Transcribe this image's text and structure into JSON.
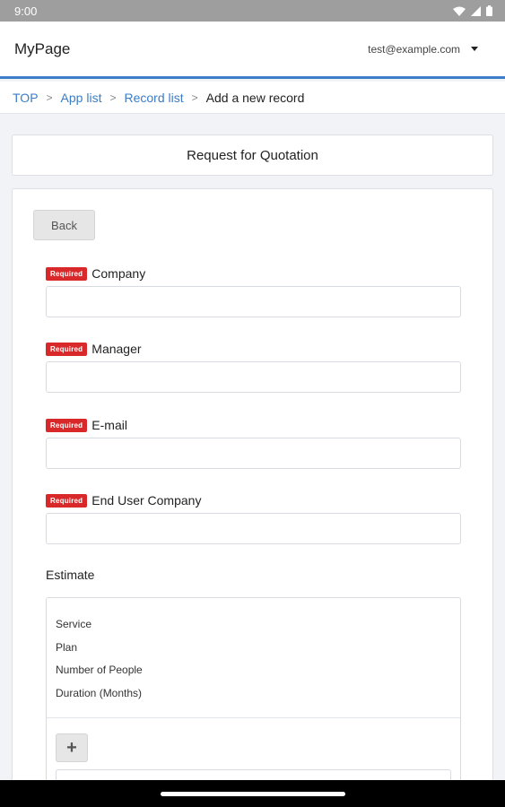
{
  "status_bar": {
    "time": "9:00",
    "icons": [
      "wifi-icon",
      "signal-icon",
      "battery-icon"
    ]
  },
  "header": {
    "app_title": "MyPage",
    "account_email": "test@example.com",
    "account_menu_icon": "caret-down-icon"
  },
  "breadcrumb": {
    "items": [
      "TOP",
      "App list",
      "Record list"
    ],
    "current": "Add a new record",
    "separator": ">"
  },
  "form": {
    "title": "Request for Quotation",
    "back_label": "Back",
    "required_badge": "Required",
    "fields": [
      {
        "label": "Company",
        "value": "",
        "required": true
      },
      {
        "label": "Manager",
        "value": "",
        "required": true
      },
      {
        "label": "E-mail",
        "value": "",
        "required": true
      },
      {
        "label": "End User Company",
        "value": "",
        "required": true
      }
    ],
    "estimate": {
      "label": "Estimate",
      "headers": [
        "Service",
        "Plan",
        "Number of People",
        "Duration (Months)"
      ],
      "add_label": "+"
    }
  },
  "colors": {
    "accent": "#3b7dc6",
    "required": "#d9282a",
    "background": "#f1f3f6"
  }
}
